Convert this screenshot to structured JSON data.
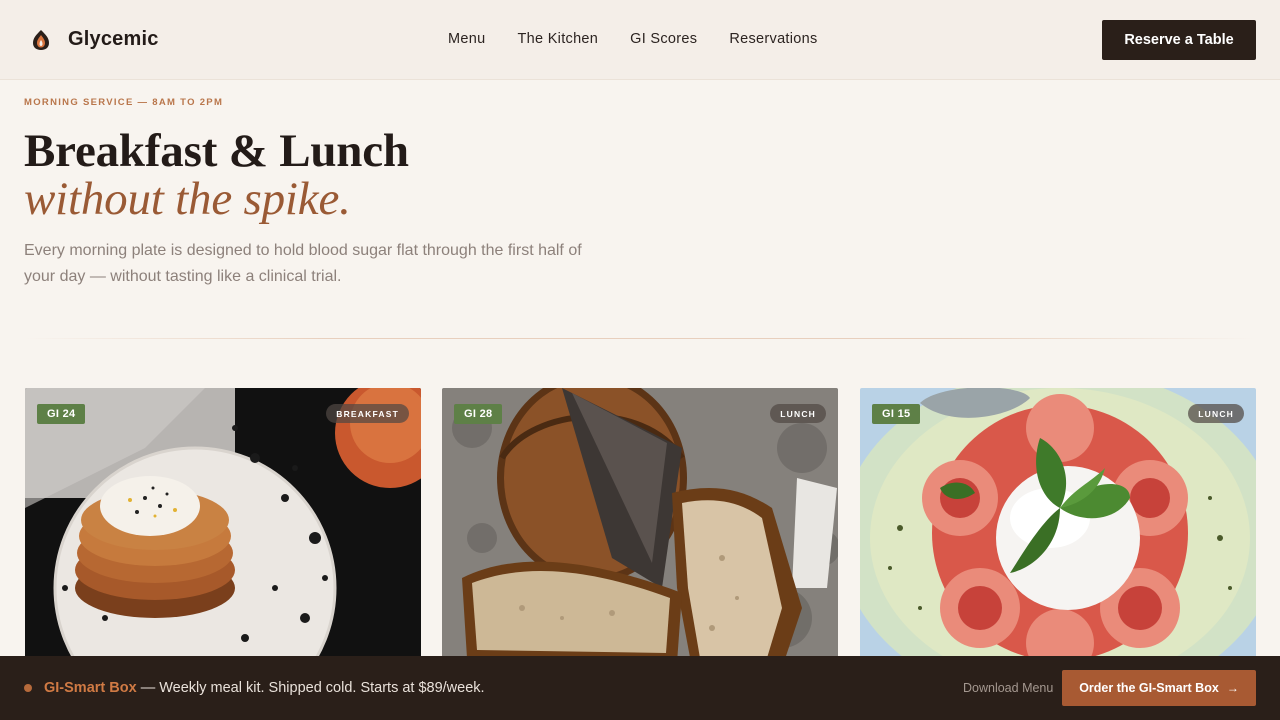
{
  "header": {
    "brand_name": "Glycemic",
    "nav": [
      {
        "label": "Menu"
      },
      {
        "label": "The Kitchen"
      },
      {
        "label": "GI Scores"
      },
      {
        "label": "Reservations"
      }
    ],
    "cta_label": "Reserve a Table"
  },
  "hero": {
    "eyebrow": "MORNING SERVICE — 8AM TO 2PM",
    "title_line1": "Breakfast & Lunch",
    "title_line2": "without the spike.",
    "lede": "Every morning plate is designed to hold blood sugar flat through the first half of your day — without tasting like a clinical trial."
  },
  "cards": [
    {
      "gi": "GI 24",
      "category": "BREAKFAST",
      "image": "pancake-stack-photo"
    },
    {
      "gi": "GI 28",
      "category": "LUNCH",
      "image": "sourdough-loaf-photo"
    },
    {
      "gi": "GI 15",
      "category": "LUNCH",
      "image": "burrata-tomato-photo"
    }
  ],
  "promo": {
    "name": "GI-Smart Box",
    "text": " — Weekly meal kit. Shipped cold. Starts at $89/week.",
    "download_label": "Download Menu",
    "order_label": "Order the GI-Smart Box"
  },
  "colors": {
    "background": "#f8f4ef",
    "dark": "#2a1f19",
    "accent": "#a85a33",
    "gi_badge": "#5e8047"
  }
}
